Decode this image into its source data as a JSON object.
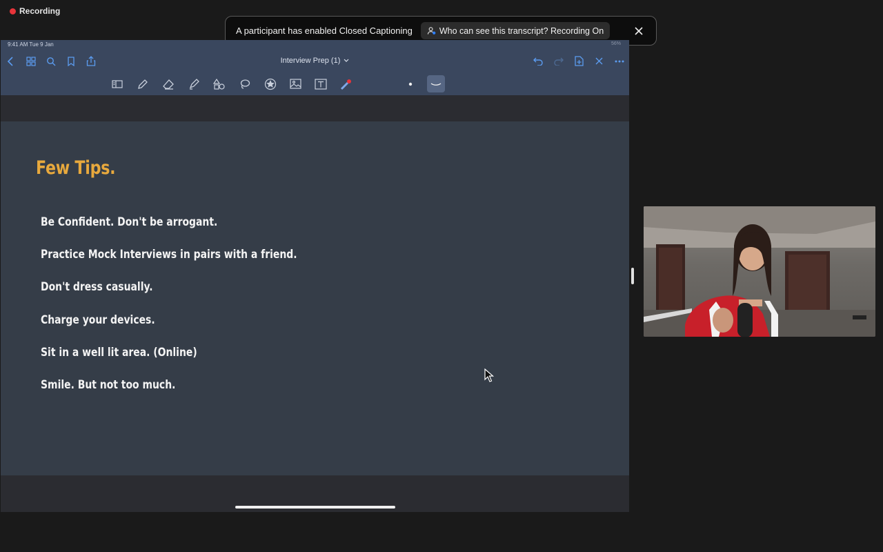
{
  "recording": {
    "label": "Recording",
    "dot_color": "#e8343a"
  },
  "caption_banner": {
    "message": "A participant has enabled Closed Captioning",
    "who_button": "Who can see this transcript? Recording On",
    "close_icon": "close-icon"
  },
  "ipad": {
    "status_bar": {
      "time": "9:41 AM   Tue 9 Jan",
      "battery": "56%"
    },
    "nav": {
      "title": "Interview Prep (1)",
      "left_icons": [
        "back-icon",
        "grid-icon",
        "search-icon",
        "bookmark-icon",
        "share-icon"
      ],
      "right_icons": [
        "undo-icon",
        "redo-icon",
        "add-page-icon",
        "close-icon",
        "more-icon"
      ]
    },
    "tools": [
      "reader-icon",
      "pen-icon",
      "eraser-icon",
      "highlighter-icon",
      "shapes-icon",
      "lasso-icon",
      "sticker-icon",
      "image-icon",
      "text-icon",
      "laser-pointer-icon",
      "dot-size-icon",
      "stroke-icon"
    ],
    "accent_color": "#e8a93d"
  },
  "page": {
    "title": "Few Tips.",
    "tips": [
      "Be Confident. Don't be arrogant.",
      "Practice Mock Interviews in pairs with a friend.",
      "Don't dress casually.",
      "Charge your devices.",
      "Sit in a well lit area. (Online)",
      "Smile. But not too much."
    ]
  },
  "video": {
    "participant": "speaker-video"
  }
}
